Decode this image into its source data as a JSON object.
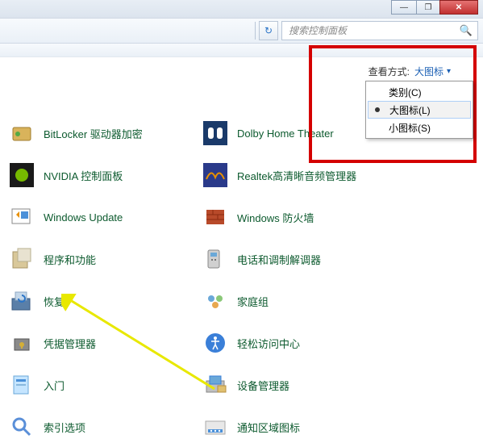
{
  "window": {
    "minimize": "—",
    "maximize": "❐",
    "close": "✕"
  },
  "toolbar": {
    "refresh_icon": "↻",
    "search_placeholder": "搜索控制面板",
    "search_icon": "🔍"
  },
  "view": {
    "label": "查看方式:",
    "current": "大图标",
    "caret": "▾",
    "options": {
      "category": "类别(C)",
      "large": "大图标(L)",
      "small": "小图标(S)"
    }
  },
  "items": {
    "col1": [
      {
        "label": "BitLocker 驱动器加密"
      },
      {
        "label": "NVIDIA 控制面板"
      },
      {
        "label": "Windows Update"
      },
      {
        "label": "程序和功能"
      },
      {
        "label": "恢复"
      },
      {
        "label": "凭据管理器"
      },
      {
        "label": "入门"
      },
      {
        "label": "索引选项"
      }
    ],
    "col2": [
      {
        "label": "Dolby Home Theater"
      },
      {
        "label": "Realtek高清晰音频管理器"
      },
      {
        "label": "Windows 防火墙"
      },
      {
        "label": "电话和调制解调器"
      },
      {
        "label": "家庭组"
      },
      {
        "label": "轻松访问中心"
      },
      {
        "label": "设备管理器"
      },
      {
        "label": "通知区域图标"
      }
    ]
  }
}
